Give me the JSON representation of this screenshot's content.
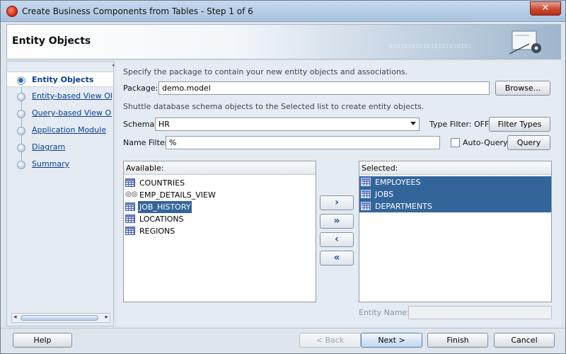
{
  "window": {
    "title": "Create Business Components from Tables - Step 1 of 6",
    "close_label": "✕"
  },
  "header": {
    "title": "Entity Objects",
    "binary_decoration": "0101010101010101010101"
  },
  "nav": {
    "items": [
      {
        "label": "Entity Objects",
        "active": true
      },
      {
        "label": "Entity-based View Objects",
        "active": false
      },
      {
        "label": "Query-based View Objects",
        "active": false
      },
      {
        "label": "Application Module",
        "active": false
      },
      {
        "label": "Diagram",
        "active": false
      },
      {
        "label": "Summary",
        "active": false
      }
    ]
  },
  "content": {
    "package_hint": "Specify the package to contain your new entity objects and associations.",
    "package_label": "Package:",
    "package_value": "demo.model",
    "browse_label": "Browse...",
    "shuttle_hint": "Shuttle database schema objects to the Selected list to create entity objects.",
    "schema_label": "Schema:",
    "schema_value": "HR",
    "type_filter_label": "Type Filter: OFF",
    "filter_types_label": "Filter Types",
    "name_filter_label": "Name Filter:",
    "name_filter_value": "%",
    "auto_query_label": "Auto-Query",
    "auto_query_checked": false,
    "query_label": "Query",
    "available_header": "Available:",
    "available": [
      {
        "name": "COUNTRIES",
        "icon": "table-icon",
        "selected": false
      },
      {
        "name": "EMP_DETAILS_VIEW",
        "icon": "view-icon",
        "selected": false
      },
      {
        "name": "JOB_HISTORY",
        "icon": "table-icon",
        "selected": true
      },
      {
        "name": "LOCATIONS",
        "icon": "table-icon",
        "selected": false
      },
      {
        "name": "REGIONS",
        "icon": "table-icon",
        "selected": false
      }
    ],
    "selected_header": "Selected:",
    "selected": [
      {
        "name": "EMPLOYEES",
        "icon": "table-icon"
      },
      {
        "name": "JOBS",
        "icon": "table-icon"
      },
      {
        "name": "DEPARTMENTS",
        "icon": "table-icon"
      }
    ],
    "shuttle": {
      "add": "›",
      "add_all": "»",
      "remove": "‹",
      "remove_all": "«"
    },
    "entity_name_label": "Entity Name:",
    "entity_name_value": ""
  },
  "footer": {
    "help": "Help",
    "back": "< Back",
    "next": "Next >",
    "finish": "Finish",
    "cancel": "Cancel"
  },
  "colors": {
    "selection": "#33659b",
    "link": "#0b3d91",
    "close_button": "#c94a2e"
  }
}
